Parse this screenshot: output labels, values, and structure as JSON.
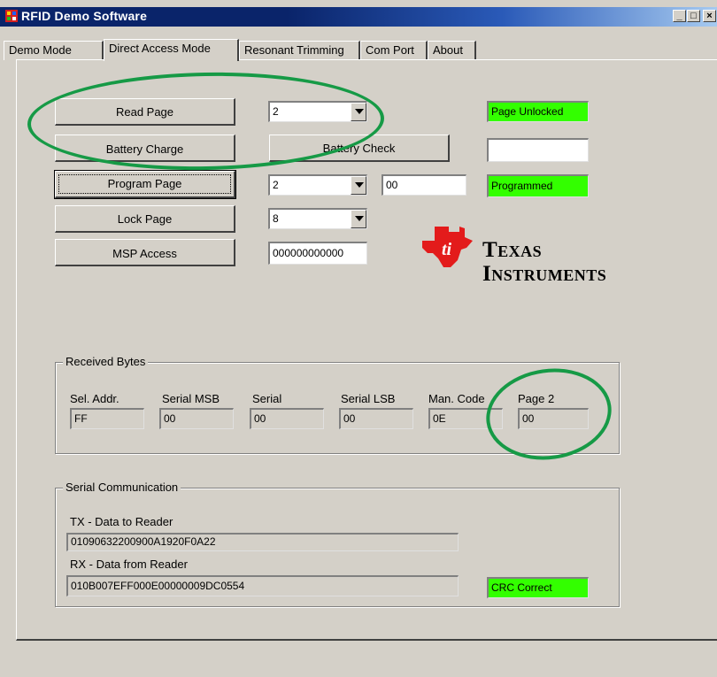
{
  "window": {
    "title": "RFID Demo Software",
    "minimize": "_",
    "maximize": "□",
    "close": "×"
  },
  "tabs": [
    "Demo Mode",
    "Direct Access Mode",
    "Resonant Trimming",
    "Com Port",
    "About"
  ],
  "buttons": {
    "read_page": "Read Page",
    "battery_charge": "Battery Charge",
    "battery_check": "Battery Check",
    "program_page": "Program Page",
    "lock_page": "Lock Page",
    "msp_access": "MSP Access"
  },
  "inputs": {
    "read_page_select": "2",
    "program_page_select": "2",
    "program_data": "00",
    "lock_page_select": "8",
    "msp_access_data": "000000000000"
  },
  "status": {
    "page_unlocked": "Page Unlocked",
    "battery_status": "",
    "programmed": "Programmed",
    "crc": "CRC Correct"
  },
  "logo": {
    "line1": "Texas",
    "line2": "Instruments"
  },
  "received": {
    "legend": "Received Bytes",
    "columns": [
      {
        "label": "Sel. Addr.",
        "value": "FF"
      },
      {
        "label": "Serial MSB",
        "value": "00"
      },
      {
        "label": "Serial",
        "value": "00"
      },
      {
        "label": "Serial LSB",
        "value": "00"
      },
      {
        "label": "Man. Code",
        "value": "0E"
      },
      {
        "label": "Page 2",
        "value": "00"
      }
    ]
  },
  "serial": {
    "legend": "Serial Communication",
    "tx_label": "TX - Data to Reader",
    "tx_value": "01090632200900A1920F0A22",
    "rx_label": "RX - Data from Reader",
    "rx_value": "010B007EFF000E00000009DC0554"
  },
  "colors": {
    "status_green": "#33ff00",
    "annotation_green": "#169a46",
    "ti_red": "#e31b1b"
  }
}
